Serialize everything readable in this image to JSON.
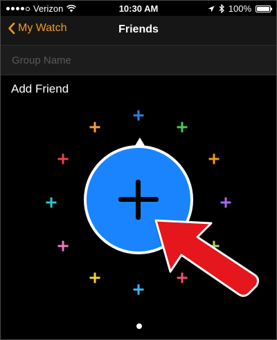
{
  "status_bar": {
    "carrier": "Verizon",
    "time": "10:30 AM",
    "battery": "100%",
    "battery_level": 1.0,
    "signal_bars_filled": 4,
    "signal_bars_total": 5
  },
  "nav": {
    "back_label": "My Watch",
    "title": "Friends"
  },
  "group_name": {
    "placeholder": "Group Name",
    "value": ""
  },
  "add_friend": {
    "label": "Add Friend"
  },
  "friend_slots": [
    {
      "name": "slot-top",
      "color": "#2f7fe0"
    },
    {
      "name": "slot-top-right-1",
      "color": "#49c85a"
    },
    {
      "name": "slot-right-1",
      "color": "#f19a22"
    },
    {
      "name": "slot-right-2",
      "color": "#a56bf0"
    },
    {
      "name": "slot-right-3",
      "color": "#b8d85a"
    },
    {
      "name": "slot-bottom-right",
      "color": "#f0506e"
    },
    {
      "name": "slot-bottom",
      "color": "#39b8f0"
    },
    {
      "name": "slot-bottom-left",
      "color": "#f5d23a"
    },
    {
      "name": "slot-left-3",
      "color": "#f07ac0"
    },
    {
      "name": "slot-left-2",
      "color": "#28c8d0"
    },
    {
      "name": "slot-left-1",
      "color": "#e8434a"
    },
    {
      "name": "slot-top-left",
      "color": "#f0a048"
    }
  ],
  "colors": {
    "accent": "#f19a22",
    "add_circle": "#1a84ff",
    "annotation_arrow": "#e5161a"
  },
  "icons": {
    "back": "chevron-left-icon",
    "add": "plus-icon",
    "wifi": "wifi-icon",
    "location": "location-arrow-icon",
    "bluetooth": "bluetooth-icon",
    "battery": "battery-icon"
  },
  "page_indicator": {
    "pages": 1,
    "current": 1
  }
}
